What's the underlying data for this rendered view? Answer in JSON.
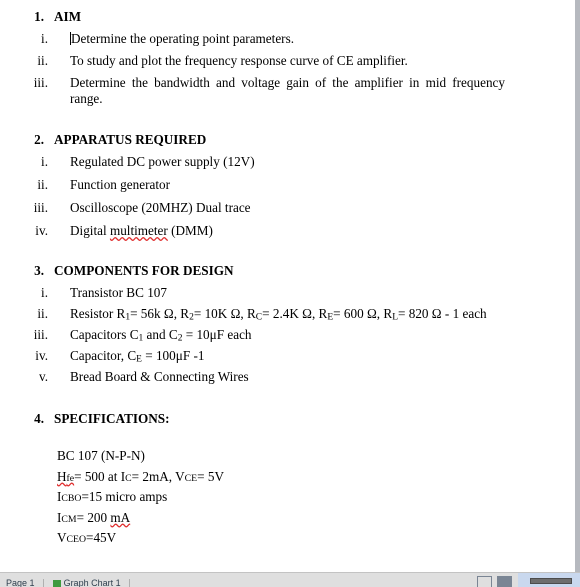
{
  "document": {
    "sections": [
      {
        "number": "1.",
        "heading": "AIM",
        "items": [
          {
            "marker": "i.",
            "text": "Determine the operating point parameters.",
            "caret_before": true,
            "justify": false
          },
          {
            "marker": "ii.",
            "text": "To study and plot the frequency response curve of CE amplifier.",
            "justify": false
          },
          {
            "marker": "iii.",
            "text": "Determine the bandwidth and voltage gain of the amplifier in mid frequency range.",
            "justify": true
          }
        ]
      },
      {
        "number": "2.",
        "heading": "APPARATUS REQUIRED",
        "items": [
          {
            "marker": "i.",
            "text": "Regulated DC power supply (12V)"
          },
          {
            "marker": "ii.",
            "text": "Function generator"
          },
          {
            "marker": "iii.",
            "text": "Oscilloscope (20MHZ) Dual trace"
          },
          {
            "marker": "iv.",
            "text": "Digital multimeter (DMM)",
            "misspelled_word": "multimeter"
          }
        ]
      },
      {
        "number": "3.",
        "heading": "COMPONENTS FOR DESIGN",
        "items": [
          {
            "marker": "i.",
            "text": "Transistor BC 107"
          },
          {
            "marker": "ii.",
            "text": "Resistor R1= 56k Ω, R2= 10K Ω, RC= 2.4K Ω, RE= 600 Ω, RL= 820 Ω - 1 each"
          },
          {
            "marker": "iii.",
            "text": "Capacitors C1 and C2 = 10μF each"
          },
          {
            "marker": "iv.",
            "text": "Capacitor, CE = 100μF -1"
          },
          {
            "marker": "v.",
            "text": "Bread Board & Connecting Wires"
          }
        ]
      },
      {
        "number": "4.",
        "heading": "SPECIFICATIONS:",
        "spec_lines": [
          "BC 107 (N-P-N)",
          "Hfe= 500 at Ic= 2mA, VCE= 5V",
          "ICBO=15 micro amps",
          "ICM= 200 mA",
          "VCEO=45V"
        ]
      }
    ]
  },
  "statusbar": {
    "page_label": "Page 1",
    "section_label": "Graph Chart 1"
  }
}
